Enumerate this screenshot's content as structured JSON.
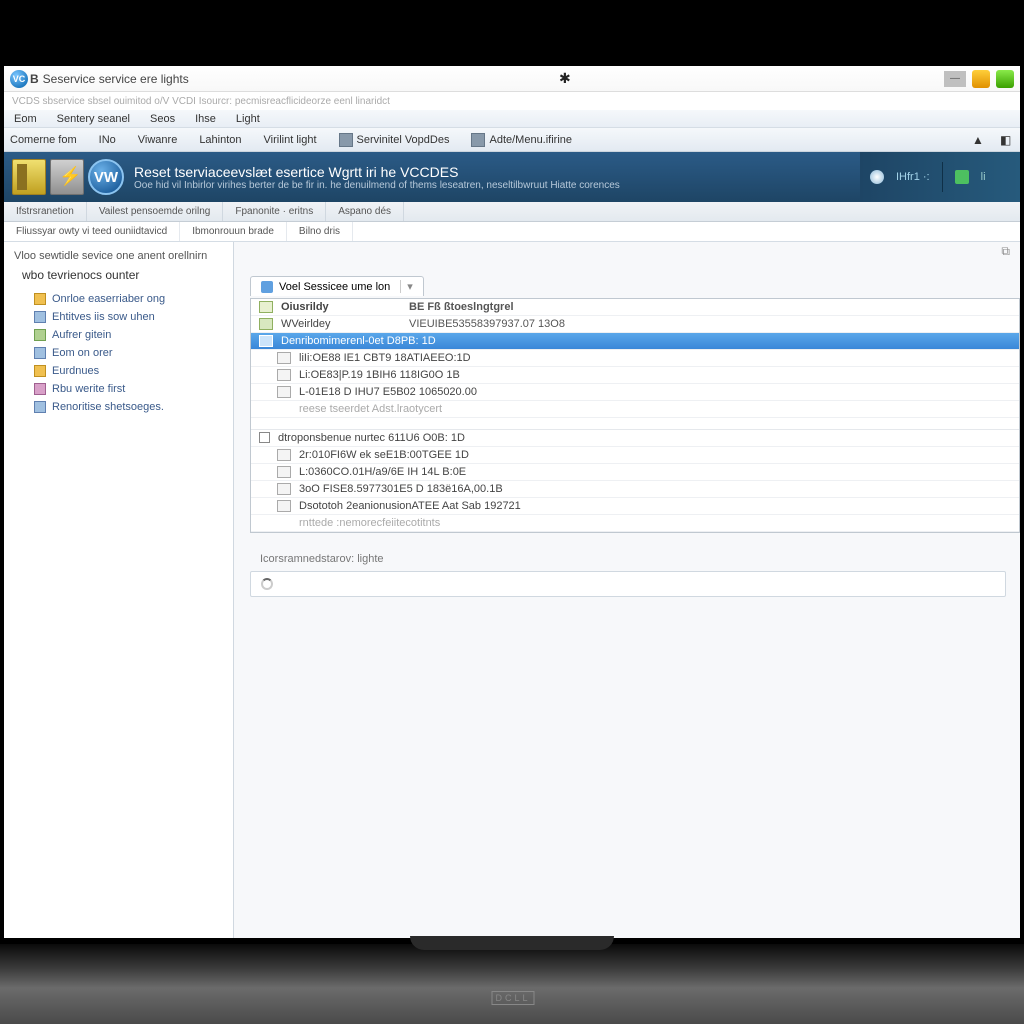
{
  "window": {
    "app_badge": "VC",
    "title": "Seservice service ere lights",
    "subtitle": "VCDS sbservice sbsel ouimitod o/V VCDI Isourcr: pecmisreacﬂicideorze eenl linaridct"
  },
  "menubar": [
    "Eom",
    "Sentery seanel",
    "Seos",
    "Ihse",
    "Light"
  ],
  "toolbar": {
    "items": [
      "Comerne fom",
      "INo",
      "Viwanre",
      "Lahinton",
      "Virilint light",
      "Servinitel VopdDes",
      "Adte/Menu.ifirine"
    ]
  },
  "banner": {
    "vw": "VW",
    "title": "Reset tserviaceevslæt esertice Wgrtt iri he VCCDES",
    "sub": "Ooe hid vil Inbirlor virihes berter de be fir in. he denuilmend of thems leseatren, neseltilbwruut Hiatte corences",
    "right_text": "IHfr1 ·:"
  },
  "tabsrow": [
    "Ifstrsranetion",
    "Vailest pensoemde orilng",
    "Fpanonite · eritns",
    "Aspano dés"
  ],
  "subtabs": [
    "Fliussyar owty vi teed ouniidtavicd",
    "Ibmonrouun brade",
    "Bilno dris"
  ],
  "sidebar": {
    "h1": "Vloo sewtidle sevice one anent orellnirn",
    "h2": "wbo tevrienocs ounter",
    "items": [
      "Onrloe easerriaber ong",
      "Ehtitves iis sow uhen",
      "Aufrer gitein",
      "Eom on orer",
      "Eurdnues",
      "Rbu werite first",
      "Renoritise shetsoeges."
    ]
  },
  "content": {
    "tab_label": "Voel Sessicee ume lon",
    "groups": [
      {
        "label": "Oiusrildy",
        "value": "BE Fß ßtoeslngtgrel",
        "rows": [
          {
            "label": "WVeirldey",
            "value": "VIEUIBE53558397937.07 13O8"
          }
        ]
      }
    ],
    "selected": {
      "label": "Denribomimerenl-0et D8PB: 1D"
    },
    "sub_rows": [
      "liIi:OE88 IE1 CBT9 18ATIAEEO:1D",
      "Li:OE83|P.19 1BIH6 118IG0O 1B",
      "L-01E18 D IHU7 E5B02 1065020.00",
      "reese tseerdet Adst.lraotycert"
    ],
    "group2": {
      "label": "dtroponsbenue nurtec 611U6 O0B: 1D",
      "rows": [
        "2r:010FI6W ek seE1B:00TGEE 1D",
        "L:0360CO.01H/a9/6E IH 14L B:0E",
        "3oO FISE8.5977301E5 D 183ë16A,00.1B",
        "Dsototoh 2eanionusionATEE Aat Sab 192721",
        "rnttede :nemorecfeiitecotitnts"
      ]
    },
    "footer_label": "Icorsramnedstarov: lighte"
  },
  "laptop_brand": "DCLL"
}
